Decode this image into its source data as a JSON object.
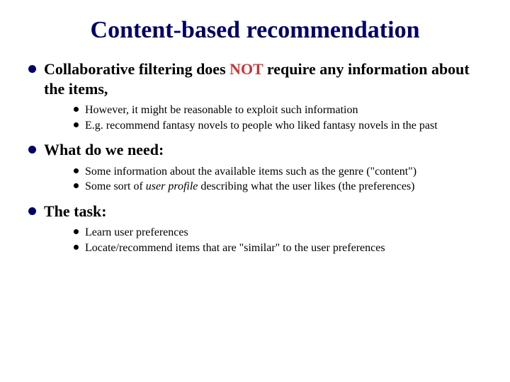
{
  "title": "Content-based recommendation",
  "items": [
    {
      "text_before": "Collaborative filtering does ",
      "text_hot": "NOT",
      "text_after": " require any information about the items,",
      "subs": [
        {
          "text": "However, it might be reasonable to exploit such information"
        },
        {
          "text": "E.g. recommend fantasy novels to people who liked fantasy novels in the past"
        }
      ]
    },
    {
      "text_before": "What do we need:",
      "text_hot": "",
      "text_after": "",
      "subs": [
        {
          "text": "Some information about the available items such as the genre (\"content\")"
        },
        {
          "text_before": "Some sort of ",
          "italic": "user profile",
          "text_after": " describing what the user likes (the preferences)"
        }
      ]
    },
    {
      "text_before": "The task:",
      "text_hot": "",
      "text_after": "",
      "subs": [
        {
          "text": "Learn user preferences"
        },
        {
          "text": "Locate/recommend items that are \"similar\" to the user preferences"
        }
      ]
    }
  ]
}
